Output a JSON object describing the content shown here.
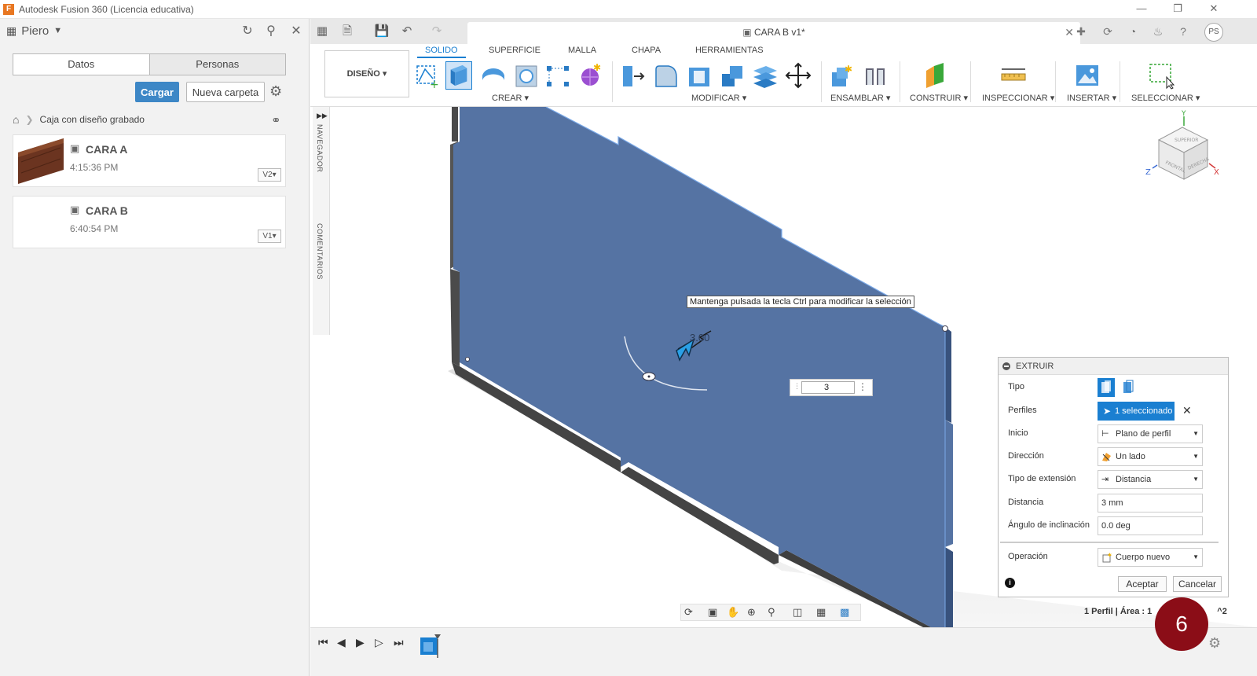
{
  "window": {
    "title": "Autodesk Fusion 360 (Licencia educativa)"
  },
  "data_panel": {
    "user": "Piero",
    "tabs": {
      "datos": "Datos",
      "personas": "Personas"
    },
    "buttons": {
      "cargar": "Cargar",
      "nueva_carpeta": "Nueva carpeta"
    },
    "breadcrumb": "Caja con diseño grabado",
    "files": [
      {
        "name": "CARA A",
        "time": "4:15:36 PM",
        "version": "V2▾"
      },
      {
        "name": "CARA B",
        "time": "6:40:54 PM",
        "version": "V1▾"
      }
    ]
  },
  "document": {
    "tab_title": "CARA B v1*"
  },
  "ribbon": {
    "design": "DISEÑO ▾",
    "tabs": [
      "SOLIDO",
      "SUPERFICIE",
      "MALLA",
      "CHAPA",
      "HERRAMIENTAS"
    ],
    "groups": {
      "crear": "CREAR ▾",
      "modificar": "MODIFICAR ▾",
      "ensamblar": "ENSAMBLAR ▾",
      "construir": "CONSTRUIR ▾",
      "inspeccionar": "INSPECCIONAR ▾",
      "insertar": "INSERTAR ▾",
      "seleccionar": "SELECCIONAR ▾"
    }
  },
  "side_strip": {
    "navegador": "NAVEGADOR",
    "comentarios": "COMENTARIOS"
  },
  "viewcube": {
    "top": "SUPERIOR",
    "front": "FRONTAL",
    "right": "DERECHA",
    "axis_x": "X",
    "axis_y": "Y",
    "axis_z": "Z"
  },
  "canvas": {
    "tooltip": "Mantenga pulsada la tecla Ctrl para modificar la selección",
    "dimension": "3.00",
    "input_value": "3"
  },
  "extrude_panel": {
    "title": "EXTRUIR",
    "labels": {
      "tipo": "Tipo",
      "perfiles": "Perfiles",
      "inicio": "Inicio",
      "direccion": "Dirección",
      "tipo_extension": "Tipo de extensión",
      "distancia": "Distancia",
      "angulo": "Ángulo de inclinación",
      "operacion": "Operación"
    },
    "values": {
      "perfiles": "1 seleccionado",
      "inicio": "Plano de perfil",
      "direccion": "Un lado",
      "tipo_extension": "Distancia",
      "distancia": "3 mm",
      "angulo": "0.0 deg",
      "operacion": "Cuerpo nuevo"
    },
    "buttons": {
      "aceptar": "Aceptar",
      "cancelar": "Cancelar"
    }
  },
  "status": {
    "text": "1 Perfil | Área : 1",
    "suffix": "^2"
  },
  "badge": "6",
  "colors": {
    "accent": "#1a7fd1",
    "body": "#5573a3",
    "badge": "#8b0d17",
    "cargar": "#3d87c6"
  }
}
